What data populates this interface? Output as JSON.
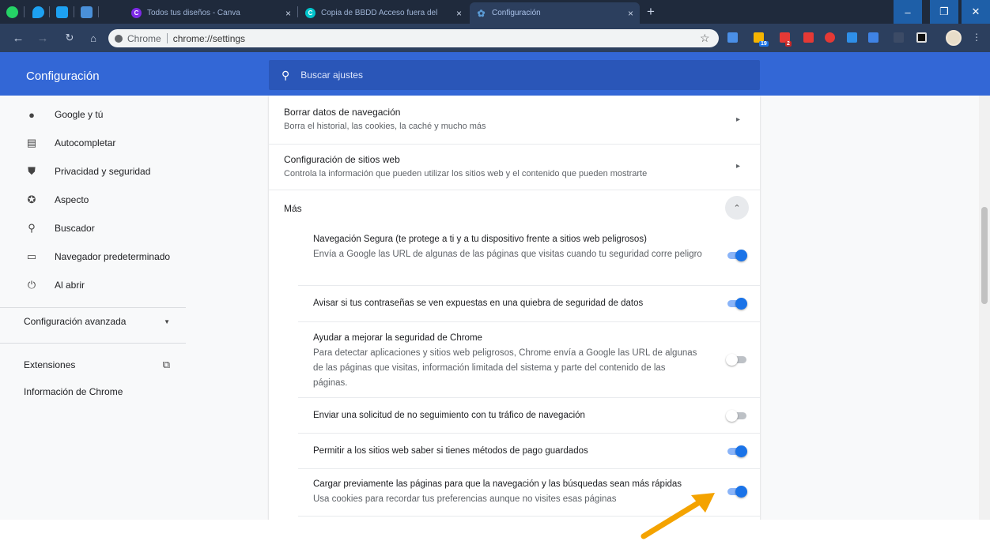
{
  "browser": {
    "tabs": [
      {
        "title": "Todos tus diseños - Canva",
        "favicon": "canva-icon",
        "color": "#7d2ae8"
      },
      {
        "title": "Copia de BBDD Acceso fuera del",
        "favicon": "canva-icon",
        "color": "#00c4cc"
      },
      {
        "title": "Configuración",
        "favicon": "gear-icon",
        "color": "#5b9bd5"
      }
    ],
    "tab_close": "×",
    "new_tab": "+",
    "window_controls": {
      "minimize": "–",
      "maximize": "❐",
      "close": "✕"
    },
    "omnibox": {
      "site_label": "Chrome",
      "url": "chrome://settings"
    },
    "extension_badges": {
      "calendar": "19",
      "mail": "2"
    }
  },
  "settings": {
    "header_title": "Configuración",
    "search_placeholder": "Buscar ajustes",
    "sidebar": {
      "items": [
        {
          "label": "Google y tú",
          "icon": "person-icon"
        },
        {
          "label": "Autocompletar",
          "icon": "clipboard-icon"
        },
        {
          "label": "Privacidad y seguridad",
          "icon": "shield-icon"
        },
        {
          "label": "Aspecto",
          "icon": "palette-icon"
        },
        {
          "label": "Buscador",
          "icon": "search-icon"
        },
        {
          "label": "Navegador predeterminado",
          "icon": "browser-icon"
        },
        {
          "label": "Al abrir",
          "icon": "power-icon"
        }
      ],
      "advanced": "Configuración avanzada",
      "extensions": "Extensiones",
      "about": "Información de Chrome"
    },
    "main": {
      "rows": [
        {
          "title": "Borrar datos de navegación",
          "subtitle": "Borra el historial, las cookies, la caché y mucho más"
        },
        {
          "title": "Configuración de sitios web",
          "subtitle": "Controla la información que pueden utilizar los sitios web y el contenido que pueden mostrarte"
        }
      ],
      "more_label": "Más",
      "toggles": [
        {
          "title": "Navegación Segura (te protege a ti y a tu dispositivo frente a sitios web peligrosos)",
          "subtitle": "Envía a Google las URL de algunas de las páginas que visitas cuando tu seguridad corre peligro",
          "enabled": true
        },
        {
          "title": "Avisar si tus contraseñas se ven expuestas en una quiebra de seguridad de datos",
          "subtitle": "",
          "enabled": true
        },
        {
          "title": "Ayudar a mejorar la seguridad de Chrome",
          "subtitle": "Para detectar aplicaciones y sitios web peligrosos, Chrome envía a Google las URL de algunas de las páginas que visitas, información limitada del sistema y parte del contenido de las páginas.",
          "enabled": false
        },
        {
          "title": "Enviar una solicitud de no seguimiento con tu tráfico de navegación",
          "subtitle": "",
          "enabled": false
        },
        {
          "title": "Permitir a los sitios web saber si tienes métodos de pago guardados",
          "subtitle": "",
          "enabled": true
        },
        {
          "title": "Cargar previamente las páginas para que la navegación y las búsquedas sean más rápidas",
          "subtitle": "Usa cookies para recordar tus preferencias aunque no visites esas páginas",
          "enabled": true
        }
      ]
    }
  },
  "colors": {
    "header": "#3367d6",
    "tabstrip": "#1f2a3c",
    "toggle_on": "#1a73e8",
    "callout_arrow": "#f4a300"
  }
}
